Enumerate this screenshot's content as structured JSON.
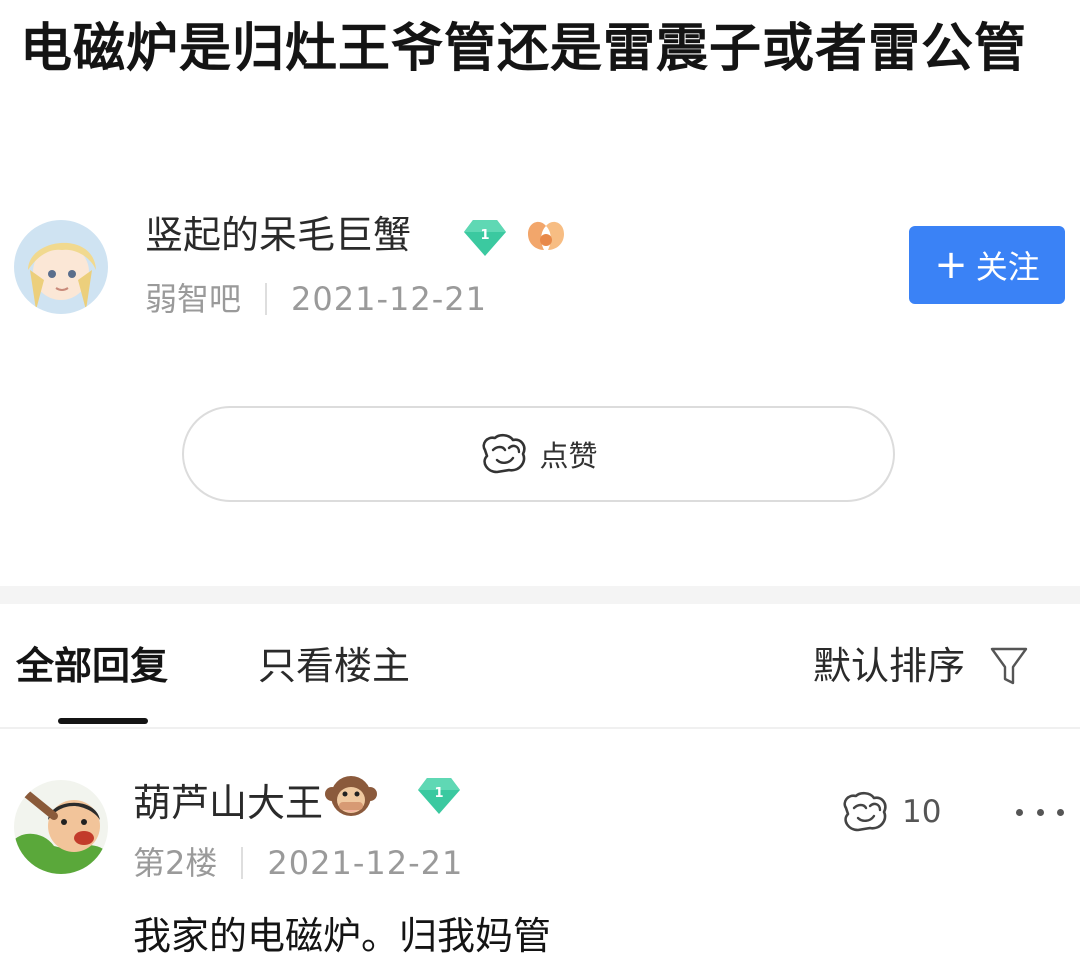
{
  "post": {
    "title": "电磁炉是归灶王爷管还是雷震子或者雷公管",
    "author": {
      "name": "竖起的呆毛巨蟹",
      "level": "1",
      "forum": "弱智吧",
      "date": "2021-12-21"
    },
    "follow_label": "关注",
    "follow_plus": "+",
    "like_label": "点赞"
  },
  "tabs": {
    "all_label": "全部回复",
    "op_label": "只看楼主",
    "sort_label": "默认排序"
  },
  "replies": [
    {
      "name": "葫芦山大王",
      "emoji": "🙊",
      "level": "1",
      "floor": "第2楼",
      "date": "2021-12-21",
      "likes": "10",
      "content": "我家的电磁炉。归我妈管"
    }
  ],
  "colors": {
    "accent_blue": "#3a82f6",
    "level_badge": "#3bc9a0",
    "meta_gray": "#9a9a9a"
  },
  "icons": {
    "like": "like-hand-icon",
    "filter": "filter-funnel-icon",
    "more": "more-dots-icon",
    "badge": "level-diamond-icon",
    "flower": "flower-badge-icon"
  }
}
